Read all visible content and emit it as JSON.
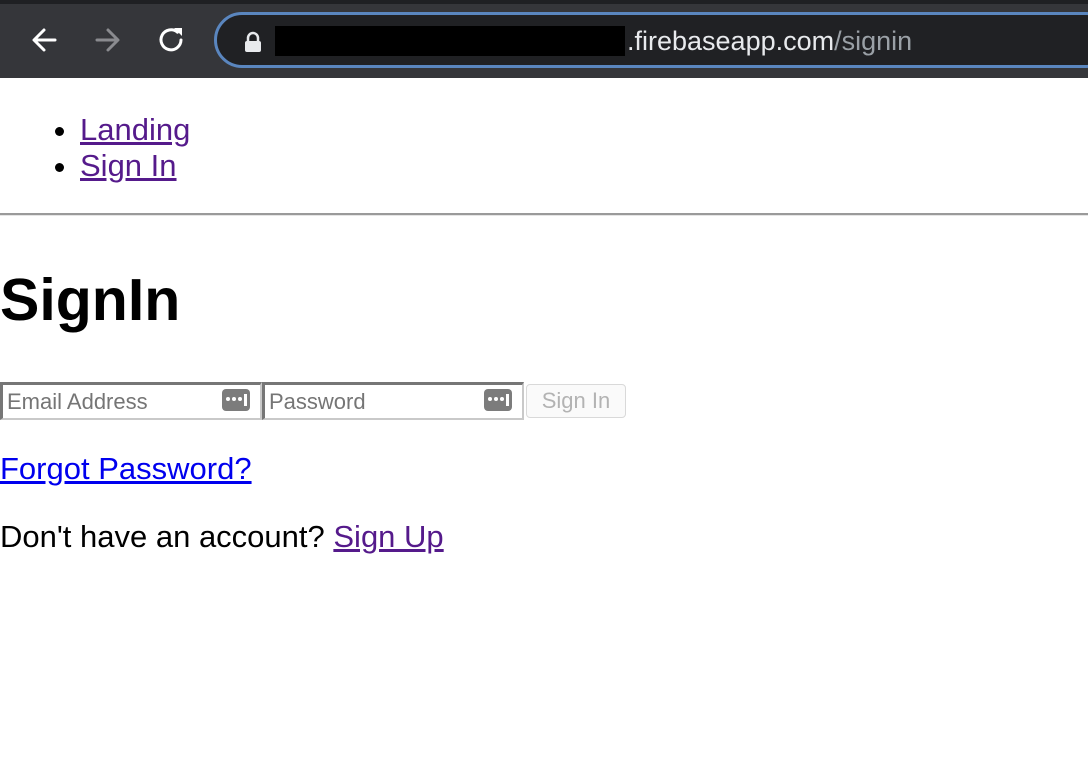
{
  "browser": {
    "url_host": ".firebaseapp.com",
    "url_path": "/signin",
    "icons": {
      "back": "arrow-left-icon",
      "forward": "arrow-right-icon",
      "reload": "reload-icon",
      "lock": "lock-icon"
    }
  },
  "nav": {
    "items": [
      {
        "label": "Landing"
      },
      {
        "label": "Sign In"
      }
    ]
  },
  "page": {
    "title": "SignIn"
  },
  "form": {
    "email_placeholder": "Email Address",
    "password_placeholder": "Password",
    "submit_label": "Sign In"
  },
  "links": {
    "forgot_password": "Forgot Password?",
    "signup_prompt": "Don't have an account? ",
    "signup_label": "Sign Up"
  },
  "colors": {
    "chrome_bg": "#35363a",
    "omnibox_border": "#5a86bf",
    "visited_link": "#551a8b",
    "link": "#0000ee"
  }
}
